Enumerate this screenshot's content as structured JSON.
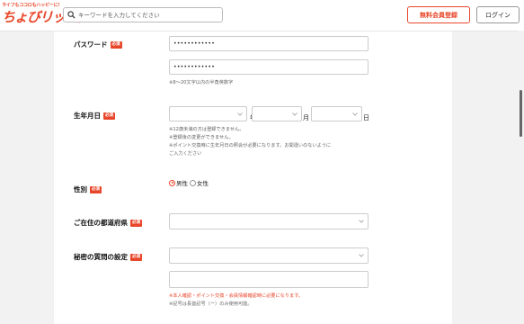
{
  "header": {
    "logo_tagline": "ライフもココロもハッピーに！",
    "logo_text": "ちょびリッチ。",
    "search_placeholder": "キーワードを入力してください",
    "register_label": "無料会員登録",
    "login_label": "ログイン"
  },
  "form": {
    "required_badge": "必須",
    "password": {
      "label": "パスワード",
      "value": "••••••••••••",
      "confirm_value": "••••••••••••",
      "note": "※8～20文字以内の半角英数字"
    },
    "birthdate": {
      "label": "生年月日",
      "year_unit": "年",
      "month_unit": "月",
      "day_unit": "日",
      "notes": [
        "※12歳未満の方は登録できません。",
        "※登録後の変更ができません。",
        "※ポイント交換時に生年月日の照会が必要になります。お間違いのないように",
        "ご入力ください"
      ]
    },
    "gender": {
      "label": "性別",
      "options": [
        {
          "label": "男性",
          "selected": true
        },
        {
          "label": "女性",
          "selected": false
        }
      ]
    },
    "prefecture": {
      "label": "ご在住の都道府県"
    },
    "secret_question": {
      "label": "秘密の質問の設定",
      "note_red": "※本人確認・ポイント交換・会員情報確認時に必要になります。",
      "note": "※記号は長音記号（ー）のみ使用可能。"
    }
  },
  "colors": {
    "accent": "#e8462a",
    "background": "#f2f2f2"
  }
}
